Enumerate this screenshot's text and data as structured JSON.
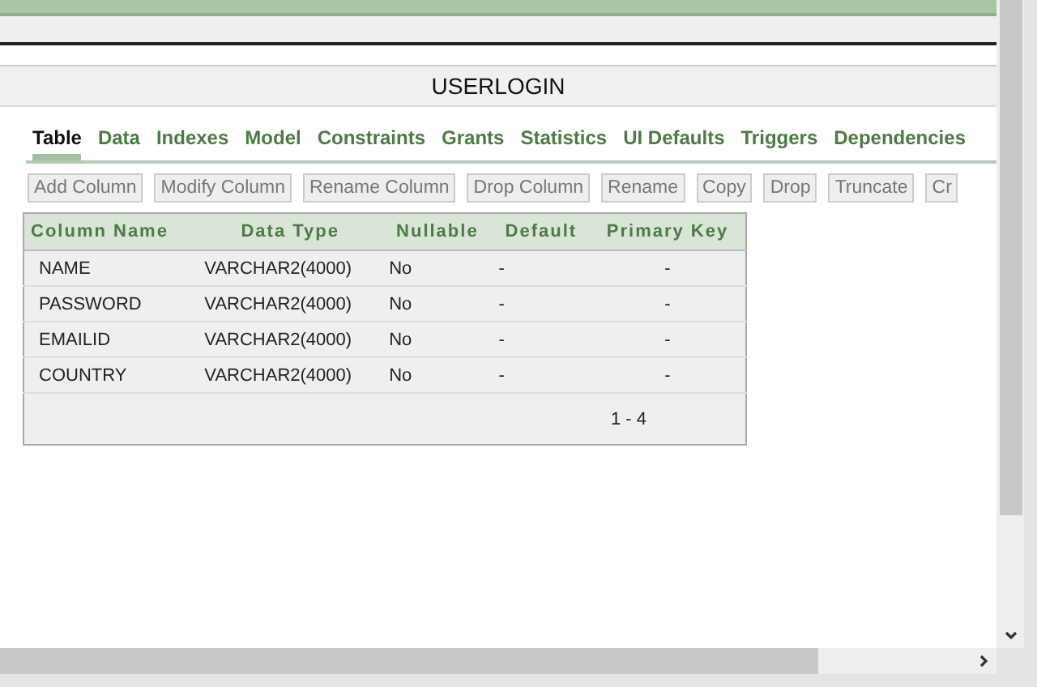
{
  "title": "USERLOGIN",
  "tabs": [
    {
      "label": "Table",
      "selected": true
    },
    {
      "label": "Data",
      "selected": false
    },
    {
      "label": "Indexes",
      "selected": false
    },
    {
      "label": "Model",
      "selected": false
    },
    {
      "label": "Constraints",
      "selected": false
    },
    {
      "label": "Grants",
      "selected": false
    },
    {
      "label": "Statistics",
      "selected": false
    },
    {
      "label": "UI Defaults",
      "selected": false
    },
    {
      "label": "Triggers",
      "selected": false
    },
    {
      "label": "Dependencies",
      "selected": false
    }
  ],
  "toolbar": [
    "Add Column",
    "Modify Column",
    "Rename Column",
    "Drop Column",
    "Rename",
    "Copy",
    "Drop",
    "Truncate",
    "Cr"
  ],
  "table": {
    "columns": [
      "Column Name",
      "Data Type",
      "Nullable",
      "Default",
      "Primary Key"
    ],
    "rows": [
      [
        "NAME",
        "VARCHAR2(4000)",
        "No",
        "-",
        "-"
      ],
      [
        "PASSWORD",
        "VARCHAR2(4000)",
        "No",
        "-",
        "-"
      ],
      [
        "EMAILID",
        "VARCHAR2(4000)",
        "No",
        "-",
        "-"
      ],
      [
        "COUNTRY",
        "VARCHAR2(4000)",
        "No",
        "-",
        "-"
      ]
    ],
    "pagination": "1 - 4"
  }
}
